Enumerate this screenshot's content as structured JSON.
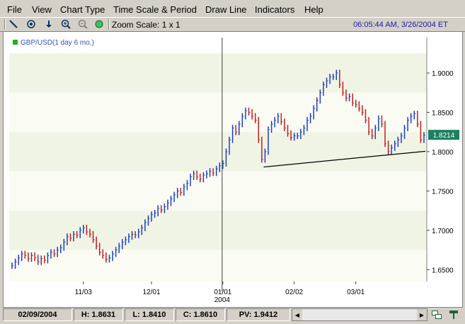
{
  "menu": [
    "File",
    "View",
    "Chart Type",
    "Time Scale & Period",
    "Draw Line",
    "Indicators",
    "Help"
  ],
  "toolbar": {
    "zoom_label": "Zoom Scale: 1 x 1",
    "datetime": "06:05:44 AM, 3/26/2004 ET"
  },
  "chart": {
    "legend": "GBP/USD(1 day 6 mo.)",
    "current_price": "1.8214",
    "y_ticks": [
      "1.9000",
      "1.8500",
      "1.8000",
      "1.7500",
      "1.7000",
      "1.6500"
    ],
    "x_ticks": [
      "11/03",
      "12/01",
      "01/01",
      "02/02",
      "03/01"
    ],
    "year_label": "2004",
    "colors": {
      "up": "#1f3fc0",
      "down": "#c01f1f",
      "band": "#f0f4e4",
      "badge": "#1a8060"
    }
  },
  "chart_data": {
    "type": "line",
    "ylim": [
      1.635,
      1.945
    ],
    "series": [
      {
        "name": "GBP/USD(1 day 6 mo.)",
        "values": [
          1.655,
          1.66,
          1.665,
          1.67,
          1.668,
          1.664,
          1.668,
          1.665,
          1.66,
          1.664,
          1.662,
          1.668,
          1.672,
          1.67,
          1.675,
          1.678,
          1.685,
          1.692,
          1.69,
          1.695,
          1.694,
          1.7,
          1.703,
          1.698,
          1.695,
          1.688,
          1.68,
          1.672,
          1.668,
          1.663,
          1.665,
          1.67,
          1.675,
          1.68,
          1.685,
          1.688,
          1.692,
          1.695,
          1.694,
          1.698,
          1.703,
          1.71,
          1.715,
          1.72,
          1.722,
          1.728,
          1.726,
          1.73,
          1.735,
          1.74,
          1.745,
          1.75,
          1.748,
          1.755,
          1.76,
          1.768,
          1.772,
          1.768,
          1.765,
          1.77,
          1.772,
          1.775,
          1.773,
          1.778,
          1.782,
          1.785,
          1.8,
          1.815,
          1.83,
          1.825,
          1.835,
          1.845,
          1.852,
          1.85,
          1.845,
          1.84,
          1.815,
          1.79,
          1.8,
          1.828,
          1.835,
          1.84,
          1.845,
          1.838,
          1.83,
          1.823,
          1.818,
          1.82,
          1.82,
          1.825,
          1.83,
          1.84,
          1.845,
          1.855,
          1.865,
          1.875,
          1.885,
          1.89,
          1.895,
          1.895,
          1.9,
          1.885,
          1.875,
          1.868,
          1.87,
          1.862,
          1.86,
          1.855,
          1.85,
          1.84,
          1.825,
          1.82,
          1.83,
          1.842,
          1.835,
          1.81,
          1.8,
          1.805,
          1.81,
          1.815,
          1.82,
          1.83,
          1.84,
          1.845,
          1.848,
          1.835,
          1.815,
          1.821
        ]
      }
    ]
  },
  "status": {
    "date": "02/09/2004",
    "high": "H: 1.8631",
    "low": "L: 1.8410",
    "close": "C: 1.8610",
    "pv": "PV: 1.9412"
  }
}
